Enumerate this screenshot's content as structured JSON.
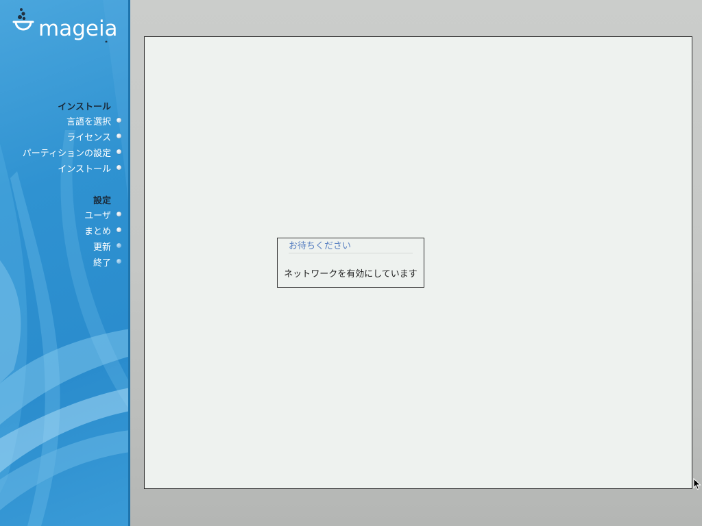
{
  "brand": {
    "logo_text": "mageia"
  },
  "sidebar": {
    "sections": [
      {
        "heading": "インストール",
        "items": [
          {
            "label": "言語を選択",
            "state": "done"
          },
          {
            "label": "ライセンス",
            "state": "done"
          },
          {
            "label": "パーティションの設定",
            "state": "done"
          },
          {
            "label": "インストール",
            "state": "done"
          }
        ]
      },
      {
        "heading": "設定",
        "items": [
          {
            "label": "ユーザ",
            "state": "done"
          },
          {
            "label": "まとめ",
            "state": "done"
          },
          {
            "label": "更新",
            "state": "pending"
          },
          {
            "label": "終了",
            "state": "pending"
          }
        ]
      }
    ]
  },
  "dialog": {
    "title": "お待ちください",
    "message": "ネットワークを有効にしています"
  },
  "colors": {
    "sidebar_blue": "#2f92d1",
    "panel_bg": "#eef2ef",
    "dialog_title": "#5b82c2",
    "heading_text": "#1a2a3a"
  },
  "icons": {
    "cursor": "mouse-pointer-icon",
    "step_done": "step-done-dot-icon",
    "step_pending": "step-pending-dot-icon"
  }
}
